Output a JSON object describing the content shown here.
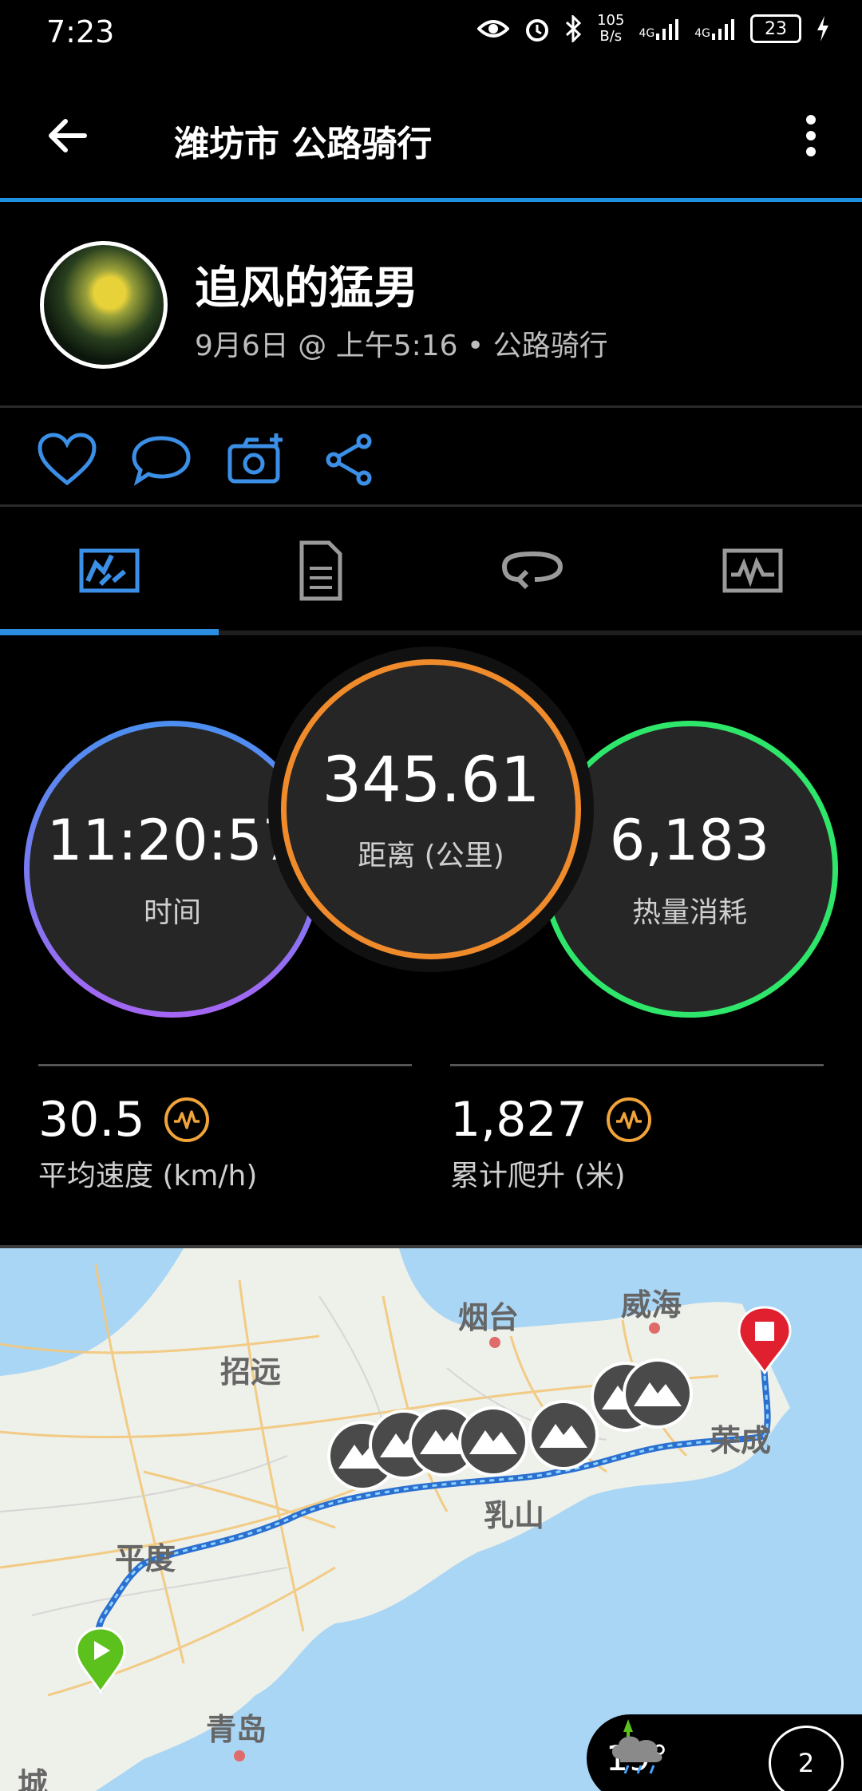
{
  "status_bar": {
    "time": "7:23",
    "speed_value": "105",
    "speed_unit": "B/s",
    "net1": "4G",
    "net2": "4G",
    "battery": "23"
  },
  "app_bar": {
    "title": "潍坊市 公路骑行"
  },
  "activity": {
    "user_name": "追风的猛男",
    "meta": "9月6日 @ 上午5:16 • 公路骑行"
  },
  "tabs": [
    {
      "icon": "summary-chart-icon",
      "active": true
    },
    {
      "icon": "details-list-icon",
      "active": false
    },
    {
      "icon": "laps-loop-icon",
      "active": false
    },
    {
      "icon": "graphs-icon",
      "active": false
    }
  ],
  "metrics": {
    "time": {
      "value": "11:20:57",
      "label": "时间"
    },
    "distance": {
      "value": "345.61",
      "label": "距离 (公里)"
    },
    "calories": {
      "value": "6,183",
      "label": "热量消耗"
    }
  },
  "stats": {
    "avg_speed": {
      "value": "30.5",
      "label": "平均速度 (km/h)"
    },
    "total_ascent": {
      "value": "1,827",
      "label": "累计爬升 (米)"
    }
  },
  "map": {
    "cities": [
      "烟台",
      "威海",
      "招远",
      "荣成",
      "乳山",
      "平度",
      "青岛",
      "城"
    ],
    "weather_temp": "19°",
    "badge_count": "2",
    "colors": {
      "route": "#2b6fd0",
      "start": "#5cc11c",
      "end": "#e0202e",
      "sea": "#a9d6f5"
    }
  },
  "colors": {
    "accent": "#1f8fe0",
    "ring_time": "#4b8ff0",
    "ring_distance": "#f08b2c",
    "ring_calories": "#2ee66a",
    "performance": "#f0a43a"
  }
}
